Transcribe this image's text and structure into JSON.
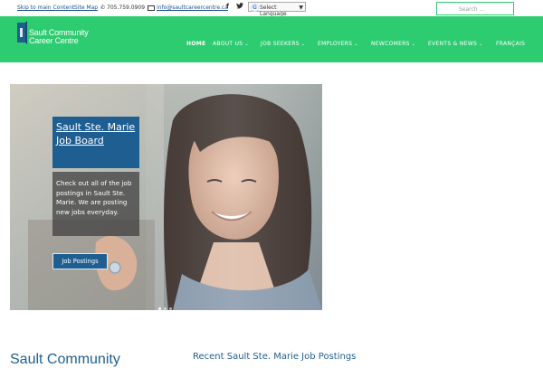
{
  "topbar": {
    "skip_link": "Skip to main Content",
    "sitemap": "Site Map",
    "phone": "705.759.0909",
    "email": "info@saultcareercentre.ca",
    "social": [
      "facebook-icon",
      "twitter-icon"
    ],
    "facebook_glyph": "f",
    "twitter_glyph": "🐦",
    "language": "Select Language",
    "language_g": "G",
    "language_arrow": "▼"
  },
  "search": {
    "placeholder": "Search ..."
  },
  "logo": {
    "line1": "Sault Community",
    "line2": "Career Centre"
  },
  "nav": [
    {
      "label": "HOME",
      "active": true,
      "dropdown": false
    },
    {
      "label": "ABOUT US",
      "dropdown": true
    },
    {
      "label": "JOB SEEKERS",
      "dropdown": true
    },
    {
      "label": "EMPLOYERS",
      "dropdown": true
    },
    {
      "label": "NEWCOMERS",
      "dropdown": true
    },
    {
      "label": "EVENTS & NEWS",
      "dropdown": true
    },
    {
      "label": "FRANÇAIS",
      "dropdown": false
    }
  ],
  "nav_chevron": "⌄",
  "slider": {
    "title": "Sault Ste. Marie Job Board",
    "description": "Check out all of the job postings in Sault Ste. Marie. We are posting new jobs everyday.",
    "button": "Job Postings",
    "slides": 3,
    "active_slide": 1
  },
  "below": {
    "left_heading": "Sault Community",
    "right_heading": "Recent Sault Ste. Marie Job Postings"
  },
  "colors": {
    "green": "#2ecc71",
    "blue": "#1f5e91",
    "link": "#1b4f8c"
  }
}
